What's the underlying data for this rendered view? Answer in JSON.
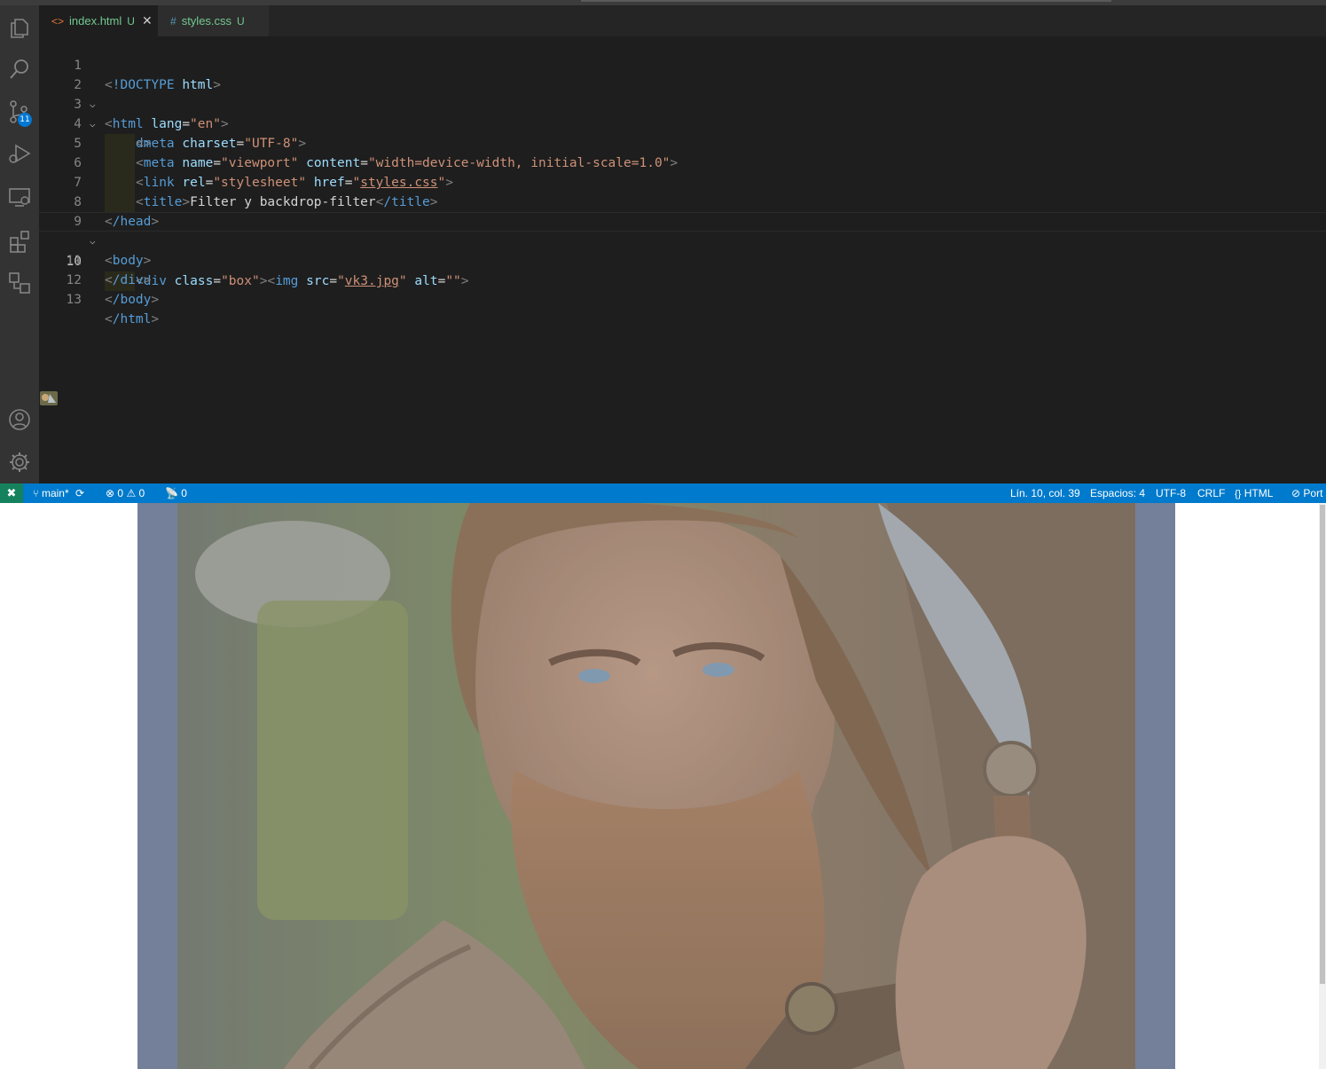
{
  "tabs": [
    {
      "icon": "<>",
      "label": "index.html",
      "status": "U",
      "close": "✕"
    },
    {
      "icon": "#",
      "label": "styles.css",
      "status": "U"
    }
  ],
  "activity": {
    "source_control_badge": "11"
  },
  "code_lines": [
    {
      "num": "1"
    },
    {
      "num": "2"
    },
    {
      "num": "3"
    },
    {
      "num": "4"
    },
    {
      "num": "5"
    },
    {
      "num": "6"
    },
    {
      "num": "7"
    },
    {
      "num": "8"
    },
    {
      "num": "9"
    },
    {
      "num": "10"
    },
    {
      "num": "11"
    },
    {
      "num": "12"
    },
    {
      "num": "13"
    }
  ],
  "code": {
    "l1_doctype": "!DOCTYPE",
    "l1_html": "html",
    "html_tag": "html",
    "lang_attr": "lang",
    "lang_val": "\"en\"",
    "head_tag": "head",
    "meta_tag": "meta",
    "charset_attr": "charset",
    "charset_val": "\"UTF-8\"",
    "name_attr": "name",
    "name_val": "\"viewport\"",
    "content_attr": "content",
    "content_val": "\"width=device-width, initial-scale=1.0\"",
    "link_tag": "link",
    "rel_attr": "rel",
    "rel_val": "\"stylesheet\"",
    "href_attr": "href",
    "href_q1": "\"",
    "href_val": "styles.css",
    "href_q2": "\"",
    "title_tag": "title",
    "title_text": "Filter y backdrop-filter",
    "title_close": "/title",
    "head_close": "/head",
    "body_tag": "body",
    "div_tag": "div",
    "class_attr": "class",
    "class_val": "\"box\"",
    "img_tag": "img",
    "src_attr": "src",
    "src_q1": "\"",
    "src_val": "vk3.jpg",
    "src_q2": "\"",
    "alt_attr": "alt",
    "alt_val": "\"\"",
    "div_close": "/div",
    "body_close": "/body",
    "html_close": "/html"
  },
  "statusbar": {
    "remote_icon": "✖",
    "branch": "main*",
    "sync": "⟳",
    "errors": "0",
    "warnings": "0",
    "ports": "0",
    "position": "Lín. 10, col. 39",
    "spaces": "Espacios: 4",
    "encoding": "UTF-8",
    "eol": "CRLF",
    "language_icon": "{}",
    "language": "HTML",
    "port_label": "Port"
  },
  "colors": {
    "statusbar": "#007acc",
    "remote": "#16825d",
    "box_background": "#748099",
    "untracked": "#73c991"
  },
  "preview": {
    "image_alt": ""
  }
}
